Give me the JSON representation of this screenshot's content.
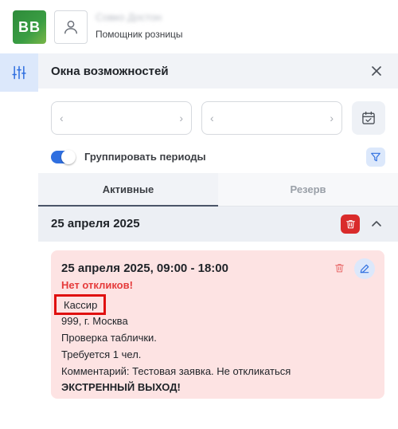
{
  "header": {
    "logo_text": "BB",
    "user_name": "Совко Достон",
    "user_role": "Помощник розницы"
  },
  "panel": {
    "title": "Окна возможностей",
    "date_from": {
      "value": "",
      "prev": "‹",
      "next": "›"
    },
    "date_to": {
      "value": "",
      "prev": "‹",
      "next": "›"
    },
    "group_periods_label": "Группировать периоды",
    "group_periods_on": true
  },
  "tabs": [
    {
      "label": "Активные",
      "active": true
    },
    {
      "label": "Резерв",
      "active": false
    }
  ],
  "group": {
    "title": "25 апреля 2025"
  },
  "card": {
    "title": "25 апреля 2025, 09:00 - 18:00",
    "status": "Нет откликов!",
    "role": "Кассир",
    "store": "999, г. Москва",
    "task": "Проверка таблички.",
    "required": "Требуется 1 чел.",
    "comment": "Комментарий: Тестовая заявка. Не откликаться",
    "emergency": "ЭКСТРЕННЫЙ ВЫХОД!"
  },
  "colors": {
    "accent": "#2f6fe0",
    "danger": "#d92b2b",
    "card_bg": "#fde3e3",
    "status_text": "#e53b3b",
    "highlight_box": "#e01010"
  },
  "icons": {
    "rail": "sliders-icon",
    "avatar": "user-icon",
    "close": "close-icon",
    "calendar": "calendar-check-icon",
    "filter": "filter-icon",
    "group_delete": "trash-icon",
    "group_collapse": "chevron-up-icon",
    "card_delete": "trash-icon",
    "card_edit": "pencil-icon"
  }
}
